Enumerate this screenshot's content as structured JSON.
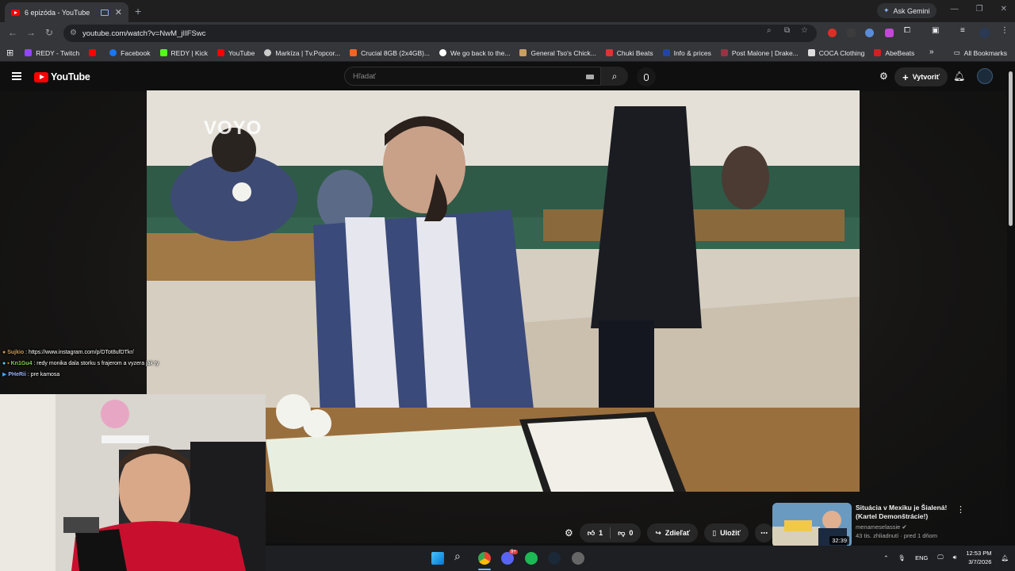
{
  "browser": {
    "tab_title": "6 epizóda - YouTube",
    "new_tab": "+",
    "ask_gemini": "Ask Gemini",
    "url": "youtube.com/watch?v=NwM_jIIFSwc",
    "bookmarks": [
      {
        "label": "REDY - Twitch",
        "color": "#9146ff"
      },
      {
        "label": "",
        "color": "#ff0000"
      },
      {
        "label": "Facebook",
        "color": "#1877f2"
      },
      {
        "label": "REDY | Kick",
        "color": "#53fc18"
      },
      {
        "label": "YouTube",
        "color": "#ff0000"
      },
      {
        "label": "Markíza | Tv.Popcor...",
        "color": "#cccccc"
      },
      {
        "label": "Crucial 8GB (2x4GB)...",
        "color": "#f26522"
      },
      {
        "label": "We go back to the...",
        "color": "#ffffff"
      },
      {
        "label": "General Tso's Chick...",
        "color": "#c8a060"
      },
      {
        "label": "Chuki Beats",
        "color": "#d33"
      },
      {
        "label": "Info & prices",
        "color": "#2244aa"
      },
      {
        "label": "Post Malone | Drake...",
        "color": "#993344"
      },
      {
        "label": "COCA Clothing",
        "color": "#dddddd"
      },
      {
        "label": "AbeBeats",
        "color": "#cc2222"
      }
    ],
    "all_bookmarks": "All Bookmarks"
  },
  "youtube": {
    "logo_text": "YouTube",
    "search_placeholder": "Hľadať",
    "create_label": "Vytvoriť",
    "watermark": "VOYO",
    "actions": {
      "likes": "1",
      "dislikes": "0",
      "share": "Zdieľať",
      "save": "Uložiť"
    },
    "related": {
      "title": "Situácia v Mexiku je Šialená! (Kartel Demonštrácie!)",
      "channel": "menameselassie",
      "meta": "43 tis. zhliadnutí · pred 1 dňom",
      "duration": "32:39"
    }
  },
  "chat": [
    {
      "user": "Sujkio",
      "message": ": https://www.instagram.com/p/DTot8ufDTkr/",
      "color": "#c79a5a"
    },
    {
      "user": "Kn1Gu4",
      "message": ": redy monika dala storku s frajerom a vyzera jak ty",
      "color": "#7cd44a"
    },
    {
      "user": "PHeRii",
      "message": ": pre kamosa",
      "color": "#9ab4ff"
    }
  ],
  "taskbar": {
    "lang": "ENG",
    "time": "12:53 PM",
    "date": "3/7/2026",
    "discord_badge": "9+"
  }
}
